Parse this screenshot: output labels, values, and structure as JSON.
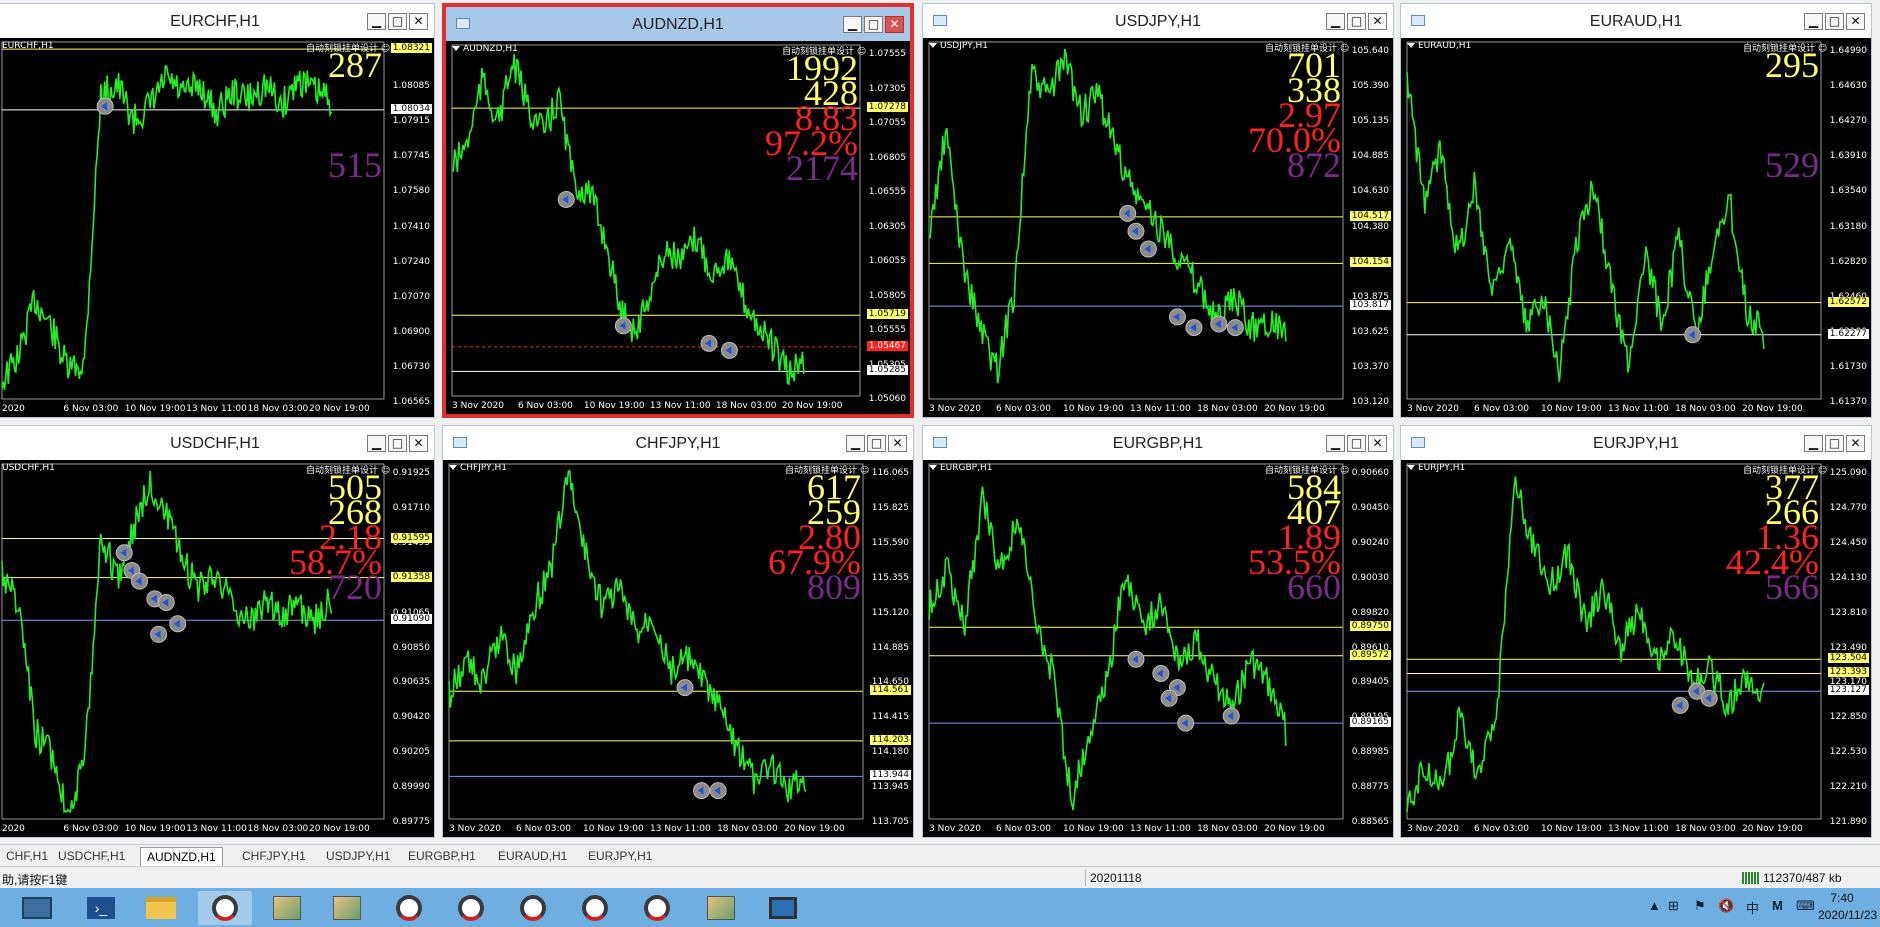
{
  "windows": [
    {
      "title": "EURCHF,H1",
      "symbol": "EURCHF,H1",
      "ea": "自动刻锁挂单设计",
      "nums": [
        {
          "v": "287",
          "c": "#ffff66"
        },
        {
          "v": "",
          "c": "#ffff66"
        },
        {
          "v": "",
          "c": "#ff2020"
        },
        {
          "v": "",
          "c": "#ff2020"
        },
        {
          "v": "515",
          "c": "#7a2a8a"
        }
      ],
      "ticks": [
        "1.08255",
        "1.08085",
        "1.07915",
        "1.07745",
        "1.07580",
        "1.07410",
        "1.07240",
        "1.07070",
        "1.06900",
        "1.06730",
        "1.06565"
      ],
      "tags": [
        {
          "v": "1.08321",
          "bg": "#ffff66",
          "fg": "#000"
        },
        {
          "v": "1.08034",
          "bg": "#ffffff",
          "fg": "#000"
        }
      ],
      "xlabels": [
        "2020",
        "6 Nov 03:00",
        "10 Nov 19:00",
        "13 Nov 11:00",
        "18 Nov 03:00",
        "20 Nov 19:00"
      ]
    },
    {
      "title": "AUDNZD,H1",
      "symbol": "AUDNZD,H1",
      "ea": "自动刻锁挂单设计",
      "nums": [
        {
          "v": "1992",
          "c": "#ffff66"
        },
        {
          "v": "428",
          "c": "#ffff66"
        },
        {
          "v": "8.83",
          "c": "#ff2020"
        },
        {
          "v": "97.2%",
          "c": "#ff2020"
        },
        {
          "v": "2174",
          "c": "#7a2a8a"
        }
      ],
      "ticks": [
        "1.07555",
        "1.07305",
        "1.07055",
        "1.06805",
        "1.06555",
        "1.06305",
        "1.06055",
        "1.05805",
        "1.05555",
        "1.05305",
        "1.05060"
      ],
      "tags": [
        {
          "v": "1.07278",
          "bg": "#ffff66",
          "fg": "#000"
        },
        {
          "v": "1.05719",
          "bg": "#ffff66",
          "fg": "#000"
        },
        {
          "v": "1.05467",
          "bg": "#ff2020",
          "fg": "#fff"
        },
        {
          "v": "1.05285",
          "bg": "#ffffff",
          "fg": "#000"
        }
      ],
      "xlabels": [
        "3 Nov 2020",
        "6 Nov 03:00",
        "10 Nov 19:00",
        "13 Nov 11:00",
        "18 Nov 03:00",
        "20 Nov 19:00"
      ]
    },
    {
      "title": "USDJPY,H1",
      "symbol": "USDJPY,H1",
      "ea": "自动刻锁挂单设计",
      "nums": [
        {
          "v": "701",
          "c": "#ffff66"
        },
        {
          "v": "338",
          "c": "#ffff66"
        },
        {
          "v": "2.97",
          "c": "#ff2020"
        },
        {
          "v": "70.0%",
          "c": "#ff2020"
        },
        {
          "v": "872",
          "c": "#7a2a8a"
        }
      ],
      "ticks": [
        "105.640",
        "105.390",
        "105.135",
        "104.885",
        "104.630",
        "104.380",
        "104.125",
        "103.875",
        "103.625",
        "103.370",
        "103.120"
      ],
      "tags": [
        {
          "v": "104.517",
          "bg": "#ffff66",
          "fg": "#000"
        },
        {
          "v": "104.154",
          "bg": "#ffff66",
          "fg": "#000"
        },
        {
          "v": "103.817",
          "bg": "#ffffff",
          "fg": "#000"
        }
      ],
      "xlabels": [
        "3 Nov 2020",
        "6 Nov 03:00",
        "10 Nov 19:00",
        "13 Nov 11:00",
        "18 Nov 03:00",
        "20 Nov 19:00"
      ]
    },
    {
      "title": "EURAUD,H1",
      "symbol": "EURAUD,H1",
      "ea": "自动刻锁挂单设计",
      "nums": [
        {
          "v": "295",
          "c": "#ffff66"
        },
        {
          "v": "",
          "c": "#ffff66"
        },
        {
          "v": "",
          "c": "#ff2020"
        },
        {
          "v": "",
          "c": "#ff2020"
        },
        {
          "v": "529",
          "c": "#7a2a8a"
        }
      ],
      "ticks": [
        "1.64990",
        "1.64630",
        "1.64270",
        "1.63910",
        "1.63540",
        "1.63180",
        "1.62820",
        "1.62460",
        "1.62100",
        "1.61730",
        "1.61370"
      ],
      "tags": [
        {
          "v": "1.62572",
          "bg": "#ffff66",
          "fg": "#000"
        },
        {
          "v": "1.62277",
          "bg": "#ffffff",
          "fg": "#000"
        }
      ],
      "xlabels": [
        "3 Nov 2020",
        "6 Nov 03:00",
        "10 Nov 19:00",
        "13 Nov 11:00",
        "18 Nov 03:00",
        "20 Nov 19:00"
      ]
    },
    {
      "title": "USDCHF,H1",
      "symbol": "USDCHF,H1",
      "ea": "自动刻锁挂单设计",
      "nums": [
        {
          "v": "505",
          "c": "#ffff66"
        },
        {
          "v": "268",
          "c": "#ffff66"
        },
        {
          "v": "2.18",
          "c": "#ff2020"
        },
        {
          "v": "58.7%",
          "c": "#ff2020"
        },
        {
          "v": "720",
          "c": "#7a2a8a"
        }
      ],
      "ticks": [
        "0.91925",
        "0.91710",
        "0.91495",
        "0.91280",
        "0.91065",
        "0.90850",
        "0.90635",
        "0.90420",
        "0.90205",
        "0.89990",
        "0.89775"
      ],
      "tags": [
        {
          "v": "0.91595",
          "bg": "#ffff66",
          "fg": "#000"
        },
        {
          "v": "0.91358",
          "bg": "#ffff66",
          "fg": "#000"
        },
        {
          "v": "0.91090",
          "bg": "#ffffff",
          "fg": "#000"
        }
      ],
      "xlabels": [
        "2020",
        "6 Nov 03:00",
        "10 Nov 19:00",
        "13 Nov 11:00",
        "18 Nov 03:00",
        "20 Nov 19:00"
      ]
    },
    {
      "title": "CHFJPY,H1",
      "symbol": "CHFJPY,H1",
      "ea": "自动刻锁挂单设计",
      "nums": [
        {
          "v": "617",
          "c": "#ffff66"
        },
        {
          "v": "259",
          "c": "#ffff66"
        },
        {
          "v": "2.80",
          "c": "#ff2020"
        },
        {
          "v": "67.9%",
          "c": "#ff2020"
        },
        {
          "v": "809",
          "c": "#7a2a8a"
        }
      ],
      "ticks": [
        "116.065",
        "115.825",
        "115.590",
        "115.355",
        "115.120",
        "114.885",
        "114.650",
        "114.415",
        "114.180",
        "113.945",
        "113.705"
      ],
      "tags": [
        {
          "v": "114.561",
          "bg": "#ffff66",
          "fg": "#000"
        },
        {
          "v": "114.203",
          "bg": "#ffff66",
          "fg": "#000"
        },
        {
          "v": "113.944",
          "bg": "#ffffff",
          "fg": "#000"
        }
      ],
      "xlabels": [
        "3 Nov 2020",
        "6 Nov 03:00",
        "10 Nov 19:00",
        "13 Nov 11:00",
        "18 Nov 03:00",
        "20 Nov 19:00"
      ]
    },
    {
      "title": "EURGBP,H1",
      "symbol": "EURGBP,H1",
      "ea": "自动刻锁挂单设计",
      "nums": [
        {
          "v": "584",
          "c": "#ffff66"
        },
        {
          "v": "407",
          "c": "#ffff66"
        },
        {
          "v": "1.89",
          "c": "#ff2020"
        },
        {
          "v": "53.5%",
          "c": "#ff2020"
        },
        {
          "v": "660",
          "c": "#7a2a8a"
        }
      ],
      "ticks": [
        "0.90660",
        "0.90450",
        "0.90240",
        "0.90030",
        "0.89820",
        "0.89610",
        "0.89405",
        "0.89195",
        "0.88985",
        "0.88775",
        "0.88565"
      ],
      "tags": [
        {
          "v": "0.89750",
          "bg": "#ffff66",
          "fg": "#000"
        },
        {
          "v": "0.89572",
          "bg": "#ffff66",
          "fg": "#000"
        },
        {
          "v": "0.89165",
          "bg": "#ffffff",
          "fg": "#000"
        }
      ],
      "xlabels": [
        "3 Nov 2020",
        "6 Nov 03:00",
        "10 Nov 19:00",
        "13 Nov 11:00",
        "18 Nov 03:00",
        "20 Nov 19:00"
      ]
    },
    {
      "title": "EURJPY,H1",
      "symbol": "EURJPY,H1",
      "ea": "自动刻锁挂单设计",
      "nums": [
        {
          "v": "377",
          "c": "#ffff66"
        },
        {
          "v": "266",
          "c": "#ffff66"
        },
        {
          "v": "1.36",
          "c": "#ff2020"
        },
        {
          "v": "42.4%",
          "c": "#ff2020"
        },
        {
          "v": "566",
          "c": "#7a2a8a"
        }
      ],
      "ticks": [
        "125.090",
        "124.770",
        "124.450",
        "124.130",
        "123.810",
        "123.490",
        "123.170",
        "122.850",
        "122.530",
        "122.210",
        "121.890"
      ],
      "tags": [
        {
          "v": "123.504",
          "bg": "#ffff66",
          "fg": "#000"
        },
        {
          "v": "123.393",
          "bg": "#ffff66",
          "fg": "#000"
        },
        {
          "v": "123.127",
          "bg": "#ffffff",
          "fg": "#000"
        }
      ],
      "xlabels": [
        "3 Nov 2020",
        "6 Nov 03:00",
        "10 Nov 19:00",
        "13 Nov 11:00",
        "18 Nov 03:00",
        "20 Nov 19:00"
      ]
    }
  ],
  "tabs": [
    "CHF,H1",
    "USDCHF,H1",
    "AUDNZD,H1",
    "CHFJPY,H1",
    "USDJPY,H1",
    "EURGBP,H1",
    "EURAUD,H1",
    "EURJPY,H1"
  ],
  "active_tab": "AUDNZD,H1",
  "status": {
    "help": "助,请按F1键",
    "date": "20201118",
    "traffic": "112370/487 kb"
  },
  "taskbar": {
    "time": "7:40",
    "date": "2020/11/23",
    "ime": "中",
    "ime2": "M"
  },
  "colors": {
    "candle": "#22ee22",
    "level_yellow": "#ffff66",
    "level_blue": "#8899ff",
    "level_red": "#ff2020"
  }
}
